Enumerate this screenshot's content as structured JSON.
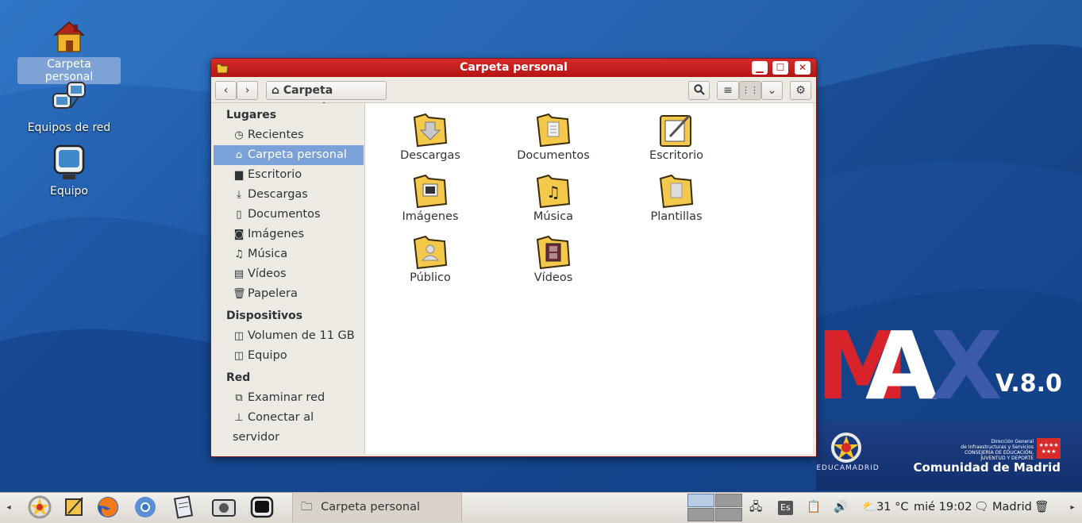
{
  "desktop": {
    "icons": [
      {
        "label": "Carpeta personal",
        "icon": "home-folder-icon",
        "selected": true
      },
      {
        "label": "Equipos de red",
        "icon": "network-icon"
      },
      {
        "label": "Equipo",
        "icon": "computer-icon"
      }
    ],
    "brand": {
      "m": "M",
      "a": "A",
      "x": "X",
      "version": "V.8.0",
      "educa": "EDUCAMADRID",
      "cm_small": "Dirección General\nde Infraestructuras y Servicios\nCONSEJERÍA DE EDUCACIÓN,\nJUVENTUD Y DEPORTE",
      "cm_big": "Comunidad de Madrid"
    }
  },
  "window": {
    "title": "Carpeta personal",
    "controls": {
      "minimize": "▁",
      "maximize": "☐",
      "close": "✕"
    },
    "toolbar": {
      "back": "‹",
      "forward": "›",
      "path": "Carpeta personal",
      "search": "search-icon",
      "list_view": "≡",
      "grid_view": "⋮⋮",
      "view_menu": "⌄",
      "settings": "⚙"
    },
    "sidebar": {
      "sections": [
        {
          "title": "Lugares",
          "items": [
            {
              "label": "Recientes",
              "glyph": "◷"
            },
            {
              "label": "Carpeta personal",
              "glyph": "⌂",
              "active": true
            },
            {
              "label": "Escritorio",
              "glyph": "▆"
            },
            {
              "label": "Descargas",
              "glyph": "⤓"
            },
            {
              "label": "Documentos",
              "glyph": "▯"
            },
            {
              "label": "Imágenes",
              "glyph": "◙"
            },
            {
              "label": "Música",
              "glyph": "♫"
            },
            {
              "label": "Vídeos",
              "glyph": "▤"
            },
            {
              "label": "Papelera",
              "glyph": "🗑"
            }
          ]
        },
        {
          "title": "Dispositivos",
          "items": [
            {
              "label": "Volumen de 11 GB",
              "glyph": "◫"
            },
            {
              "label": "Equipo",
              "glyph": "◫"
            }
          ]
        },
        {
          "title": "Red",
          "items": [
            {
              "label": "Examinar red",
              "glyph": "⧉"
            },
            {
              "label": "Conectar al servidor",
              "glyph": "⊥"
            }
          ]
        }
      ]
    },
    "files": [
      {
        "label": "Descargas",
        "emblem": "down-arrow"
      },
      {
        "label": "Documentos",
        "emblem": "document"
      },
      {
        "label": "Escritorio",
        "emblem": "pencil-note"
      },
      {
        "label": "Imágenes",
        "emblem": "picture"
      },
      {
        "label": "Música",
        "emblem": "music-note"
      },
      {
        "label": "Plantillas",
        "emblem": "template"
      },
      {
        "label": "Público",
        "emblem": "person"
      },
      {
        "label": "Vídeos",
        "emblem": "film"
      }
    ]
  },
  "taskbar": {
    "task_label": "Carpeta personal",
    "keyboard": "Es",
    "weather": "31 °C",
    "clock": "mié 19:02",
    "location": "Madrid",
    "left_arrow": "◂",
    "right_arrow": "▸"
  }
}
